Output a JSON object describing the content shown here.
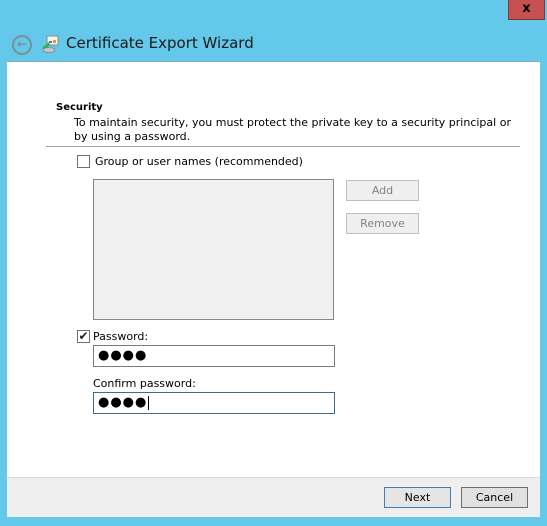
{
  "window": {
    "title": "Certificate Export Wizard",
    "close_label": "x"
  },
  "icons": {
    "back": "back-arrow-icon",
    "wizard": "certificate-wizard-icon"
  },
  "page": {
    "section_title": "Security",
    "description": "To maintain security, you must protect the private key to a security principal or by using a password.",
    "group_option": {
      "label": "Group or user names (recommended)",
      "checked": false
    },
    "group_list": [],
    "add_label": "Add",
    "remove_label": "Remove",
    "password_option": {
      "label": "Password:",
      "checked": true,
      "check_glyph": "✔"
    },
    "password_value": "●●●●",
    "confirm_label": "Confirm password:",
    "confirm_value": "●●●●"
  },
  "footer": {
    "next_label": "Next",
    "cancel_label": "Cancel"
  }
}
